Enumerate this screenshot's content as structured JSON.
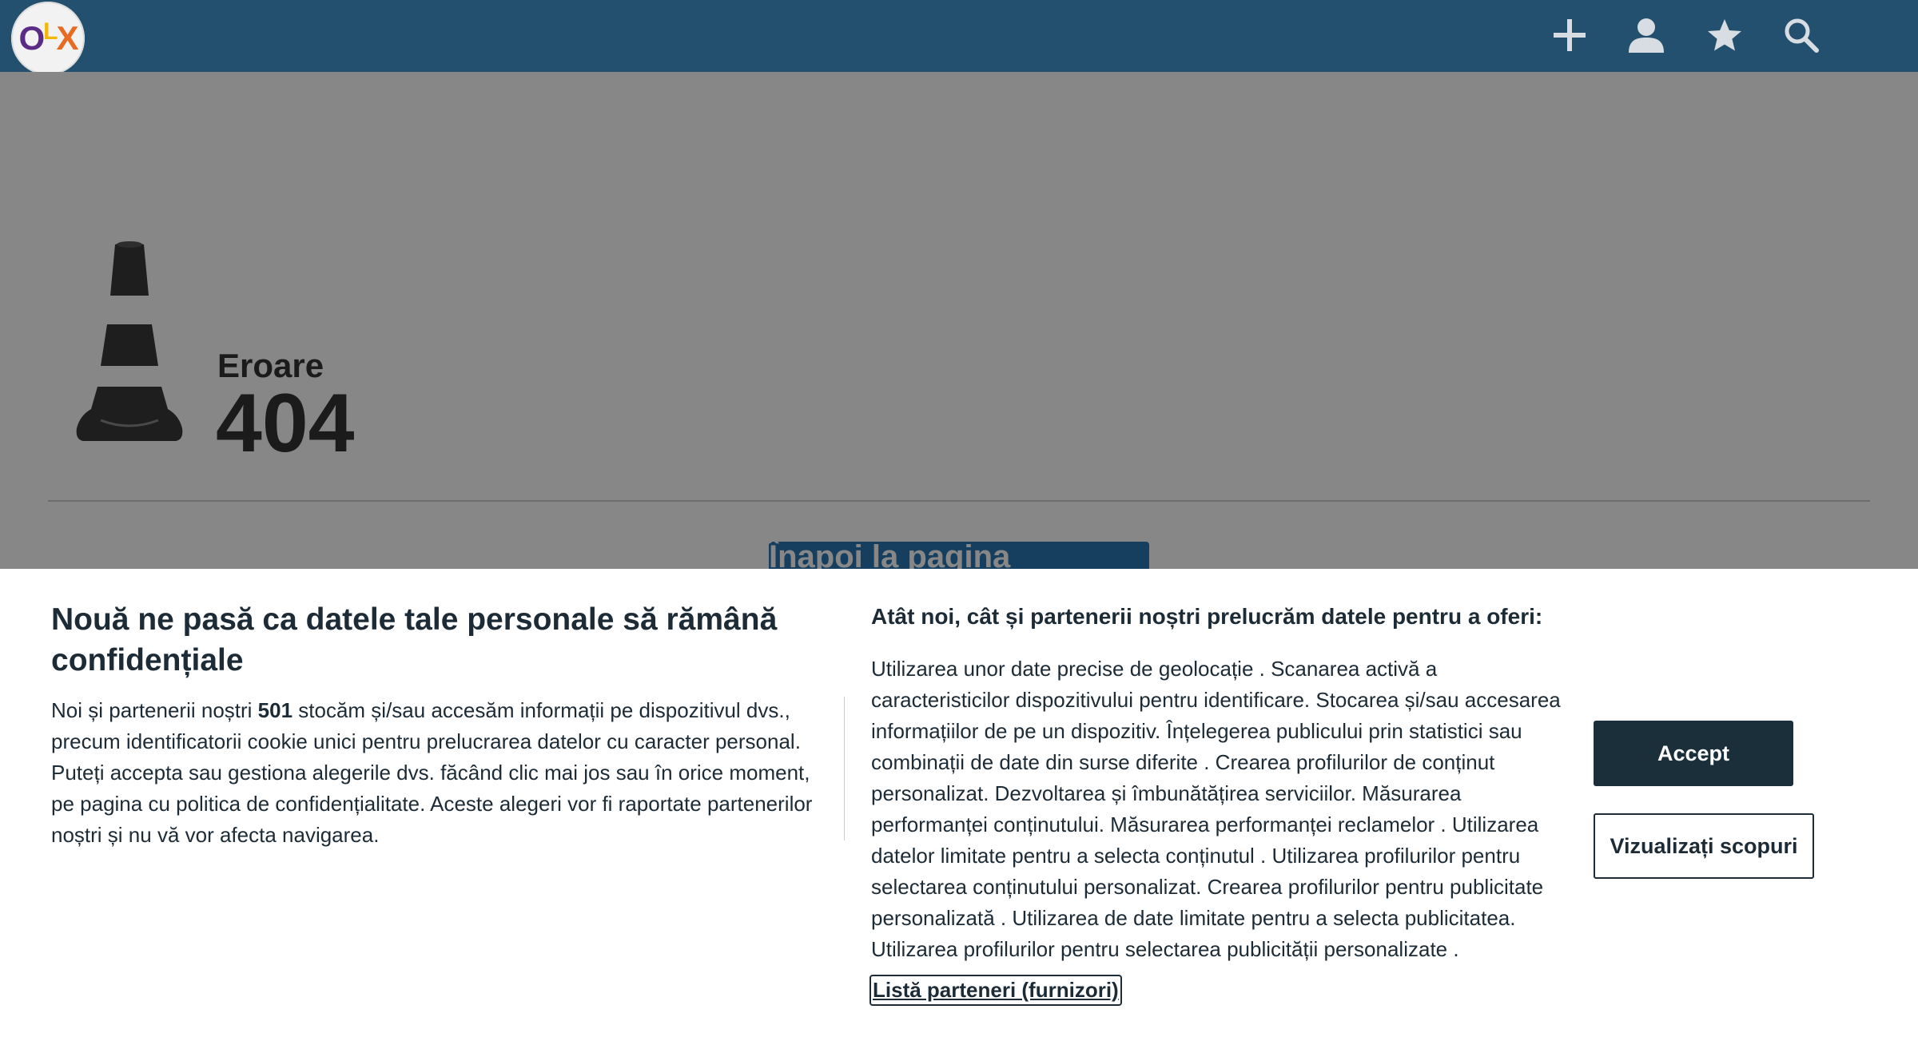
{
  "header": {
    "logo": {
      "o": "O",
      "l": "L",
      "x": "X"
    },
    "icons": [
      "plus-icon",
      "user-icon",
      "star-icon",
      "search-icon"
    ]
  },
  "error": {
    "label": "Eroare",
    "code": "404",
    "home_button": "Înapoi la pagina principală"
  },
  "consent": {
    "title": "Nouă ne pasă ca datele tale personale să rămână confidențiale",
    "text_before": "Noi și partenerii noștri ",
    "partners_count": "501",
    "text_after": " stocăm și/sau accesăm informații pe dispozitivul dvs., precum identificatorii cookie unici pentru prelucrarea datelor cu caracter personal. Puteți accepta sau gestiona alegerile dvs. făcând clic mai jos sau în orice moment, pe pagina cu politica de confidențialitate. Aceste alegeri vor fi raportate partenerilor noștri și nu vă vor afecta navigarea.",
    "purposes_title": "Atât noi, cât și partenerii noștri prelucrăm datele pentru a oferi:",
    "purposes_text": "Utilizarea unor date precise de geolocație . Scanarea activă a caracteristicilor dispozitivului pentru identificare. Stocarea și/sau accesarea informațiilor de pe un dispozitiv. Înțelegerea publicului prin statistici sau combinații de date din surse diferite . Crearea profilurilor de conținut personalizat. Dezvoltarea și îmbunătățirea serviciilor. Măsurarea performanței conținutului. Măsurarea performanței reclamelor . Utilizarea datelor limitate pentru a selecta conținutul . Utilizarea profilurilor pentru selectarea conținutului personalizat. Crearea profilurilor pentru publicitate personalizată . Utilizarea de date limitate pentru a selecta publicitatea. Utilizarea profilurilor pentru selectarea publicității personalizate .",
    "partners_link": "Listă parteneri (furnizori)",
    "accept_button": "Accept",
    "purposes_button": "Vizualizați scopuri"
  }
}
